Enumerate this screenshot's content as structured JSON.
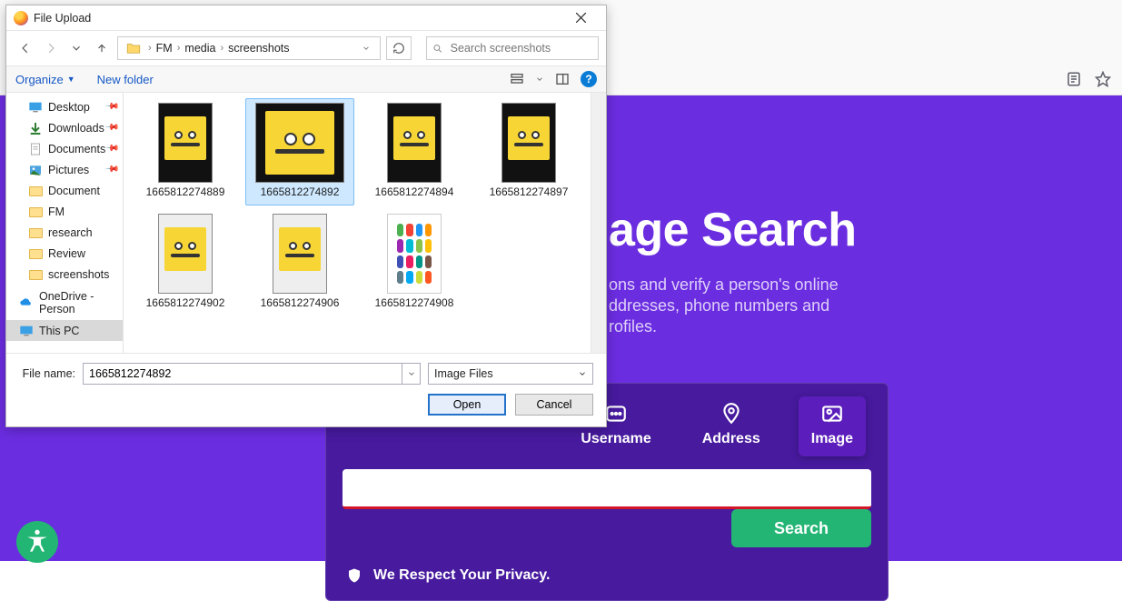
{
  "page": {
    "title_fragment": "age Search",
    "sub1": "ons and verify a person's online",
    "sub2": "ddresses, phone numbers and",
    "sub3": "rofiles.",
    "tabs": {
      "username": "Username",
      "address": "Address",
      "image": "Image"
    },
    "search_btn": "Search",
    "privacy": "We Respect Your Privacy."
  },
  "dialog": {
    "title": "File Upload",
    "breadcrumb": [
      "FM",
      "media",
      "screenshots"
    ],
    "search_placeholder": "Search screenshots",
    "organize": "Organize",
    "new_folder": "New folder",
    "sidebar": {
      "desktop": "Desktop",
      "downloads": "Downloads",
      "documents": "Documents",
      "pictures": "Pictures",
      "document": "Document",
      "fm": "FM",
      "research": "research",
      "review": "Review",
      "screenshots": "screenshots",
      "onedrive": "OneDrive - Person",
      "thispc": "This PC"
    },
    "files": {
      "f0": "1665812274889",
      "f1": "1665812274892",
      "f2": "1665812274894",
      "f3": "1665812274897",
      "f4": "1665812274902",
      "f5": "1665812274906",
      "f6": "1665812274908"
    },
    "footer": {
      "label": "File name:",
      "value": "1665812274892",
      "type": "Image Files",
      "open": "Open",
      "cancel": "Cancel"
    }
  }
}
